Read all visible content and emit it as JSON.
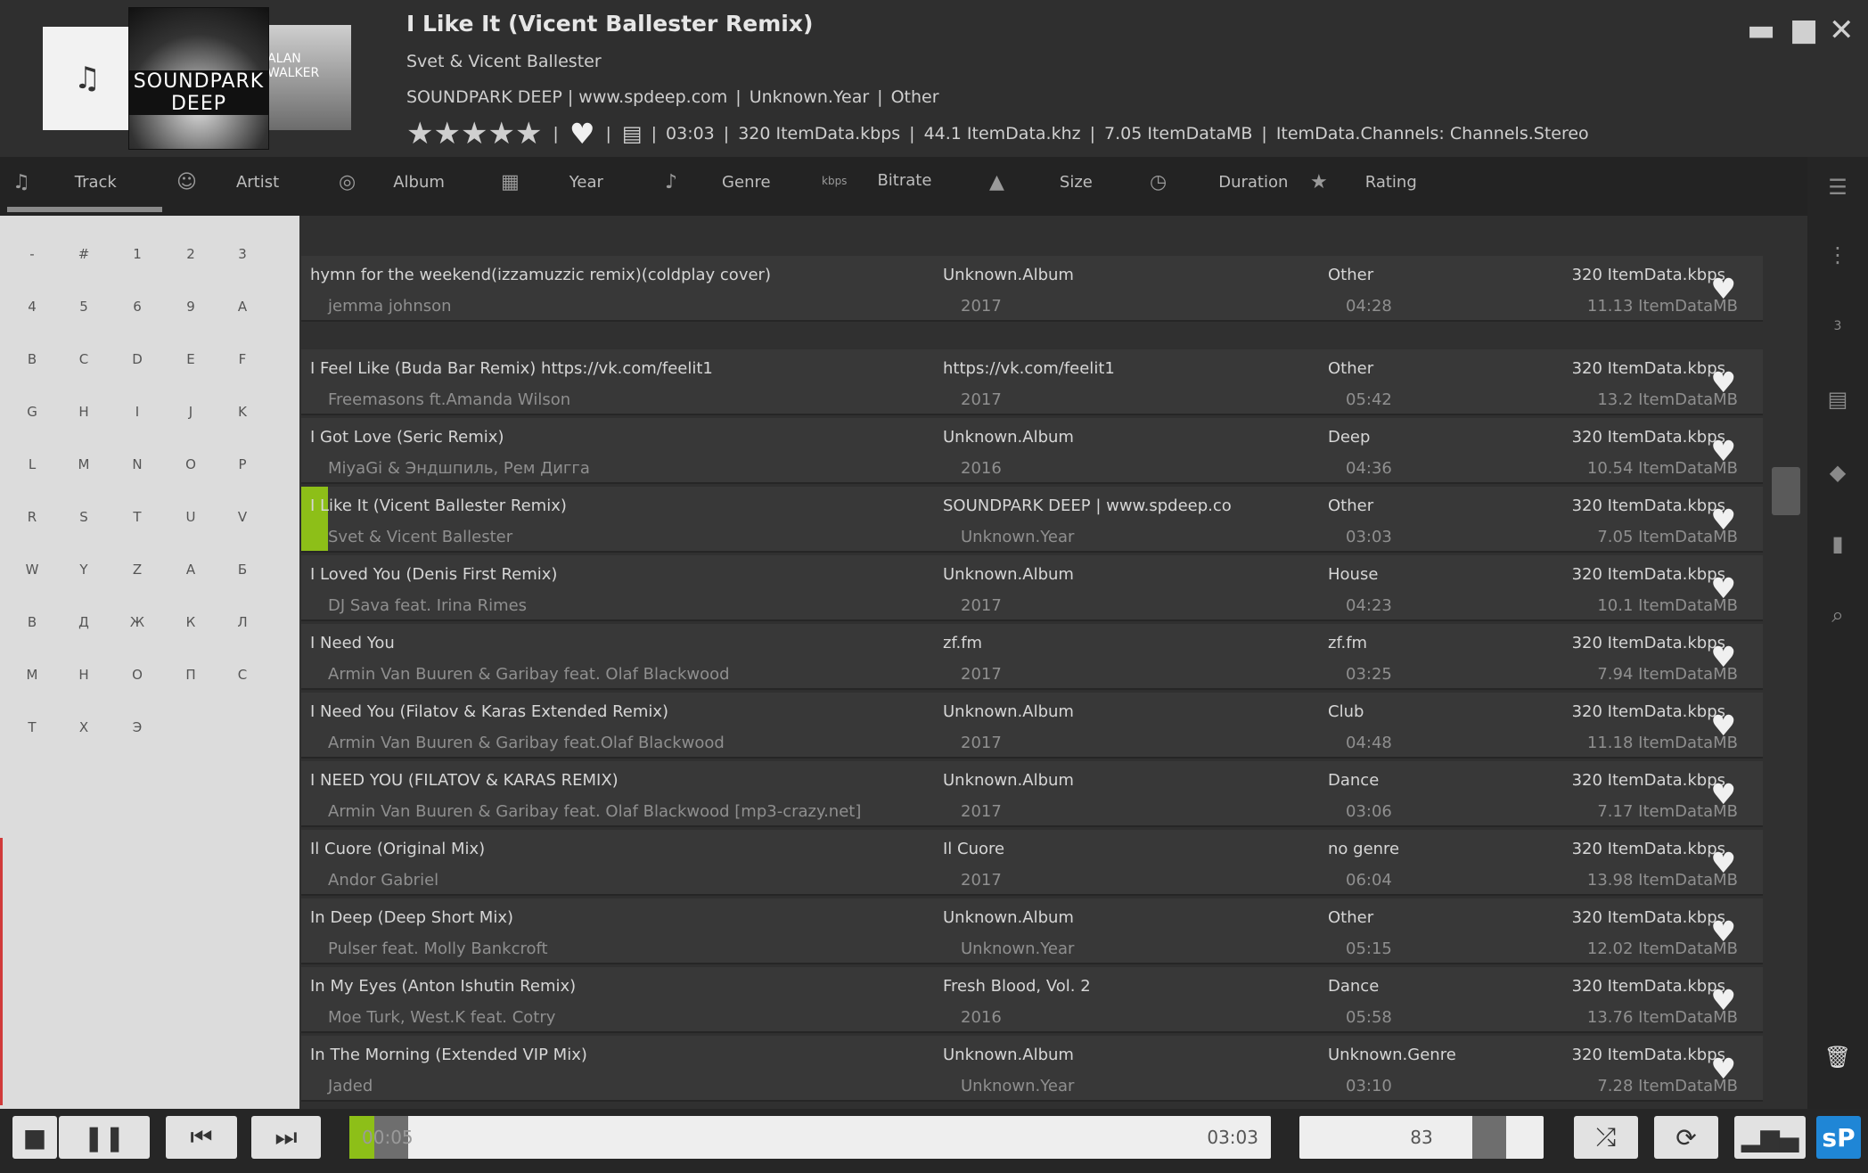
{
  "now_playing": {
    "cover_label": "SOUNDPARK DEEP",
    "side_cover_label": "ALAN WALKER",
    "title": "I Like It (Vicent Ballester Remix)",
    "artist": "Svet & Vicent Ballester",
    "album": "SOUNDPARK DEEP | www.spdeep.com",
    "year": "Unknown.Year",
    "genre": "Other",
    "duration": "03:03",
    "bitrate": "320 ItemData.kbps",
    "frequency": "44.1 ItemData.khz",
    "size": "7.05 ItemDataMB",
    "channels": "ItemData.Channels: Channels.Stereo",
    "rating": 5
  },
  "columns": [
    "Track",
    "Artist",
    "Album",
    "Year",
    "Genre",
    "Bitrate",
    "Size",
    "Duration",
    "Rating"
  ],
  "columns_bitrate_icon": "kbps",
  "alphabet": [
    "-",
    "#",
    "1",
    "2",
    "3",
    "4",
    "5",
    "6",
    "9",
    "A",
    "B",
    "C",
    "D",
    "E",
    "F",
    "G",
    "H",
    "I",
    "J",
    "K",
    "L",
    "M",
    "N",
    "O",
    "P",
    "R",
    "S",
    "T",
    "U",
    "V",
    "W",
    "Y",
    "Z",
    "А",
    "Б",
    "В",
    "Д",
    "Ж",
    "К",
    "Л",
    "М",
    "Н",
    "О",
    "П",
    "С",
    "Т",
    "Х",
    "Э"
  ],
  "right_strip": {
    "counter": "3"
  },
  "tracks": [
    {
      "title": "hymn for the weekend(izzamuzzic remix)(coldplay cover)",
      "artist": "jemma johnson",
      "album": "Unknown.Album",
      "year": "2017",
      "genre": "Other",
      "duration": "04:28",
      "bitrate": "320 ItemData.kbps",
      "size": "11.13 ItemDataMB"
    },
    {
      "title": "I Feel Like (Buda Bar Remix) https://vk.com/feelit1",
      "artist": "Freemasons ft.Amanda Wilson",
      "album": "https://vk.com/feelit1",
      "year": "2017",
      "genre": "Other",
      "duration": "05:42",
      "bitrate": "320 ItemData.kbps",
      "size": "13.2 ItemDataMB"
    },
    {
      "title": "I Got Love (Seric Remix)",
      "artist": "MiyaGi & Эндшпиль, Рем Дигга",
      "album": "Unknown.Album",
      "year": "2016",
      "genre": "Deep",
      "duration": "04:36",
      "bitrate": "320 ItemData.kbps",
      "size": "10.54 ItemDataMB"
    },
    {
      "title": "I Like It (Vicent Ballester Remix)",
      "artist": "Svet & Vicent Ballester",
      "album": "SOUNDPARK DEEP | www.spdeep.co",
      "year": "Unknown.Year",
      "genre": "Other",
      "duration": "03:03",
      "bitrate": "320 ItemData.kbps",
      "size": "7.05 ItemDataMB",
      "playing": true
    },
    {
      "title": "I Loved You (Denis First Remix)",
      "artist": "DJ Sava feat. Irina Rimes",
      "album": "Unknown.Album",
      "year": "2017",
      "genre": "House",
      "duration": "04:23",
      "bitrate": "320 ItemData.kbps",
      "size": "10.1 ItemDataMB"
    },
    {
      "title": "I Need You",
      "artist": "Armin Van Buuren & Garibay feat. Olaf Blackwood",
      "album": "zf.fm",
      "year": "2017",
      "genre": "zf.fm",
      "duration": "03:25",
      "bitrate": "320 ItemData.kbps",
      "size": "7.94 ItemDataMB"
    },
    {
      "title": "I Need You (Filatov & Karas Extended Remix)",
      "artist": "Armin Van Buuren & Garibay feat.Olaf Blackwood",
      "album": "Unknown.Album",
      "year": "2017",
      "genre": "Club",
      "duration": "04:48",
      "bitrate": "320 ItemData.kbps",
      "size": "11.18 ItemDataMB"
    },
    {
      "title": "I NEED YOU (FILATOV & KARAS REMIX)",
      "artist": "Armin Van Buuren & Garibay feat. Olaf Blackwood [mp3-crazy.net]",
      "album": "Unknown.Album",
      "year": "2017",
      "genre": "Dance",
      "duration": "03:06",
      "bitrate": "320 ItemData.kbps",
      "size": "7.17 ItemDataMB"
    },
    {
      "title": "Il Cuore (Original Mix)",
      "artist": "Andor Gabriel",
      "album": "Il Cuore",
      "year": "2017",
      "genre": "no genre",
      "duration": "06:04",
      "bitrate": "320 ItemData.kbps",
      "size": "13.98 ItemDataMB"
    },
    {
      "title": "In Deep (Deep Short Mix)",
      "artist": "Pulser feat. Molly Bankcroft",
      "album": "Unknown.Album",
      "year": "Unknown.Year",
      "genre": "Other",
      "duration": "05:15",
      "bitrate": "320 ItemData.kbps",
      "size": "12.02 ItemDataMB"
    },
    {
      "title": "In My Eyes (Anton Ishutin Remix)",
      "artist": "Moe Turk, West.K feat. Cotry",
      "album": "Fresh Blood, Vol. 2",
      "year": "2016",
      "genre": "Dance",
      "duration": "05:58",
      "bitrate": "320 ItemData.kbps",
      "size": "13.76 ItemDataMB"
    },
    {
      "title": "In The Morning (Extended VIP Mix)",
      "artist": "Jaded",
      "album": "Unknown.Album",
      "year": "Unknown.Year",
      "genre": "Unknown.Genre",
      "duration": "03:10",
      "bitrate": "320 ItemData.kbps",
      "size": "7.28 ItemDataMB"
    }
  ],
  "player": {
    "elapsed": "00:05",
    "total": "03:03",
    "progress": 0.027,
    "volume": "83",
    "logo": "sP"
  },
  "colors": {
    "accent": "#8dbf18",
    "logo_bg": "#1f86d6"
  }
}
